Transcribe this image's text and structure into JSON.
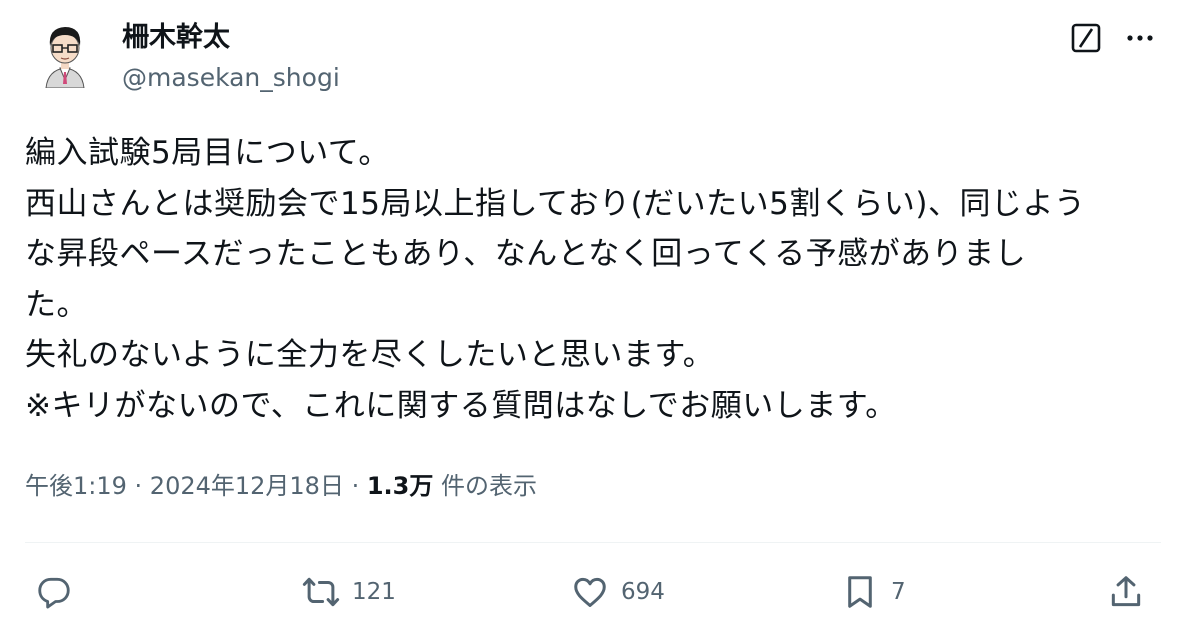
{
  "author": {
    "display_name": "柵木幹太",
    "handle": "@masekan_shogi",
    "avatar_icon": "cartoon-avatar-icon"
  },
  "header_actions": {
    "grok_icon": "grok-slash-icon",
    "more_icon": "more-dots-icon"
  },
  "tweet": {
    "lines": [
      "編入試験5局目について。",
      "西山さんとは奨励会で15局以上指しており(だいたい5割くらい)、同じよう",
      "な昇段ペースだったこともあり、なんとなく回ってくる予感がありまし",
      "た。",
      "失礼のないように全力を尽くしたいと思います。",
      "※キリがないので、これに関する質問はなしでお願いします。"
    ]
  },
  "meta": {
    "time": "午後1:19",
    "date": "2024年12月18日",
    "separator": " · ",
    "views_count": "1.3万",
    "views_label": " 件の表示"
  },
  "actions": {
    "reply": {
      "icon": "reply-icon",
      "count": ""
    },
    "retweet": {
      "icon": "retweet-icon",
      "count": "121"
    },
    "like": {
      "icon": "heart-icon",
      "count": "694"
    },
    "bookmark": {
      "icon": "bookmark-icon",
      "count": "7"
    },
    "share": {
      "icon": "share-icon",
      "count": ""
    }
  },
  "colors": {
    "text_primary": "#0f1419",
    "text_secondary": "#536471",
    "divider": "#eff3f4"
  }
}
